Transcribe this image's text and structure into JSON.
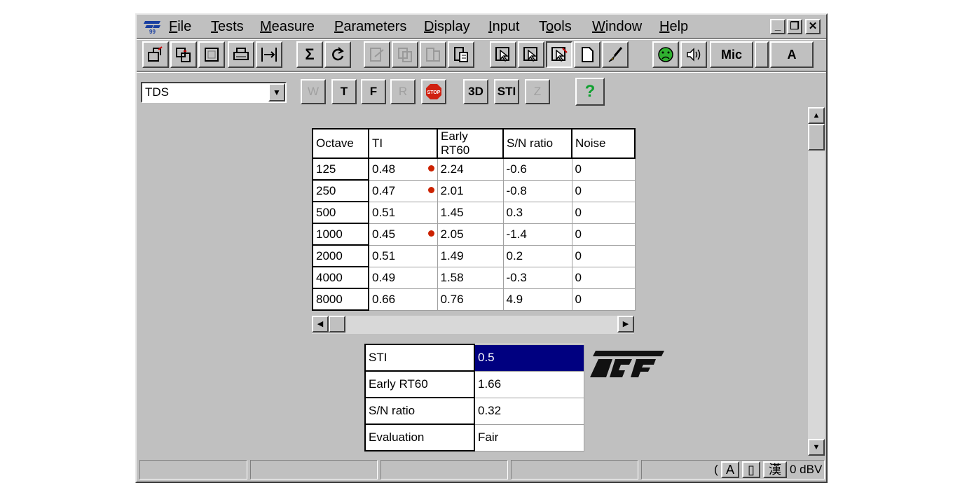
{
  "menu": {
    "items": [
      {
        "label": "File",
        "mnemonic": "F",
        "rest": "ile"
      },
      {
        "label": "Tests",
        "mnemonic": "T",
        "rest": "ests"
      },
      {
        "label": "Measure",
        "mnemonic": "M",
        "rest": "easure"
      },
      {
        "label": "Parameters",
        "mnemonic": "P",
        "rest": "arameters"
      },
      {
        "label": "Display",
        "mnemonic": "D",
        "rest": "isplay"
      },
      {
        "label": "Input",
        "mnemonic": "I",
        "rest": "nput"
      },
      {
        "label": "Tools",
        "mnemonic": "o",
        "pre": "T",
        "rest": "ols"
      },
      {
        "label": "Window",
        "mnemonic": "W",
        "rest": "indow"
      },
      {
        "label": "Help",
        "mnemonic": "H",
        "rest": "elp"
      }
    ]
  },
  "toolbar": {
    "sum_label": "Σ",
    "mic_label": "Mic",
    "a_label": "A"
  },
  "toolbar2": {
    "combo_value": "TDS",
    "w": "W",
    "t": "T",
    "f": "F",
    "r": "R",
    "stop": "STOP",
    "three_d": "3D",
    "sti": "STI",
    "z": "Z",
    "help": "?"
  },
  "octave_table": {
    "headers": [
      "Octave",
      "TI",
      "Early RT60",
      "S/N ratio",
      "Noise"
    ],
    "rows": [
      {
        "octave": "125",
        "ti": "0.48",
        "flag": true,
        "rt60": "2.24",
        "sn": "-0.6",
        "noise": "0"
      },
      {
        "octave": "250",
        "ti": "0.47",
        "flag": true,
        "rt60": "2.01",
        "sn": "-0.8",
        "noise": "0"
      },
      {
        "octave": "500",
        "ti": "0.51",
        "flag": false,
        "rt60": "1.45",
        "sn": "0.3",
        "noise": "0"
      },
      {
        "octave": "1000",
        "ti": "0.45",
        "flag": true,
        "rt60": "2.05",
        "sn": "-1.4",
        "noise": "0"
      },
      {
        "octave": "2000",
        "ti": "0.51",
        "flag": false,
        "rt60": "1.49",
        "sn": "0.2",
        "noise": "0"
      },
      {
        "octave": "4000",
        "ti": "0.49",
        "flag": false,
        "rt60": "1.58",
        "sn": "-0.3",
        "noise": "0"
      },
      {
        "octave": "8000",
        "ti": "0.66",
        "flag": false,
        "rt60": "0.76",
        "sn": "4.9",
        "noise": "0"
      }
    ]
  },
  "summary": [
    {
      "label": "STI",
      "value": "0.5",
      "selected": true
    },
    {
      "label": "Early RT60",
      "value": "1.66",
      "selected": false
    },
    {
      "label": "S/N ratio",
      "value": "0.32",
      "selected": false
    },
    {
      "label": "Evaluation",
      "value": "Fair",
      "selected": false
    }
  ],
  "status": {
    "left_text": "(",
    "right_text": "0 dBV",
    "ime_a": "A",
    "ime_kanji": "漢"
  },
  "colors": {
    "window": "#c0c0c0",
    "selection": "#000080",
    "flag_dot": "#cc2200"
  }
}
